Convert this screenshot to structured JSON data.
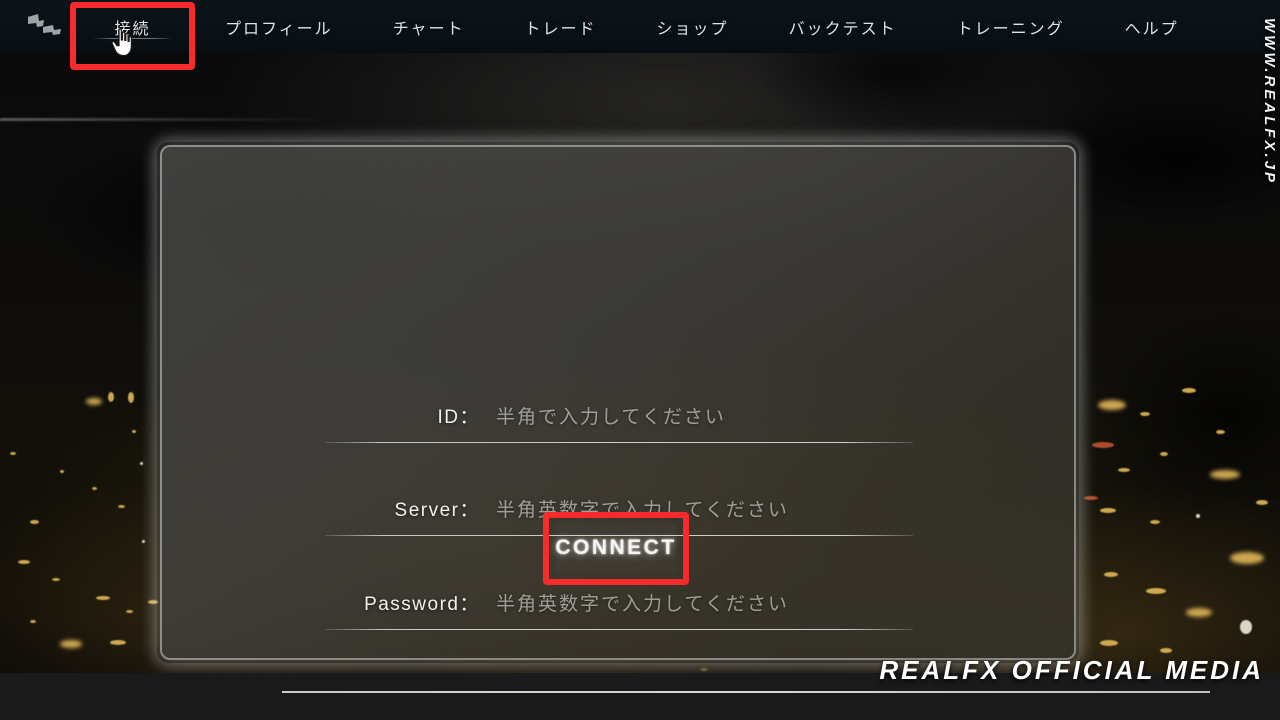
{
  "app": {
    "site_url": "WWW.REALFX.JP",
    "media_watermark": "REALFX OFFICIAL MEDIA",
    "logo_icon": "plug-connector-icon",
    "cursor_icon": "pointing-hand-cursor-icon",
    "accent_highlight_color": "#f72b2b"
  },
  "nav": {
    "items": [
      {
        "label": "接続",
        "active": true
      },
      {
        "label": "プロフィール",
        "active": false
      },
      {
        "label": "チャート",
        "active": false
      },
      {
        "label": "トレード",
        "active": false
      },
      {
        "label": "ショップ",
        "active": false
      },
      {
        "label": "バックテスト",
        "active": false
      },
      {
        "label": "トレーニング",
        "active": false
      },
      {
        "label": "ヘルプ",
        "active": false
      }
    ]
  },
  "login_dialog": {
    "fields": [
      {
        "label": "ID：",
        "value": "",
        "placeholder": "半角で入力してください"
      },
      {
        "label": "Server：",
        "value": "",
        "placeholder": "半角英数字で入力してください"
      },
      {
        "label": "Password：",
        "value": "",
        "placeholder": "半角英数字で入力してください"
      }
    ],
    "connect_button": "CONNECT"
  }
}
